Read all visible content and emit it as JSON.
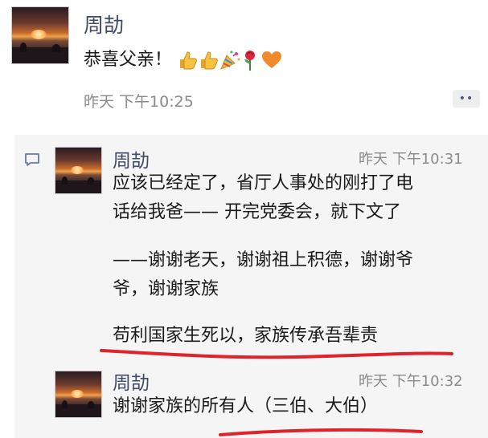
{
  "post": {
    "author": "周劼",
    "message": "恭喜父亲！",
    "emojis": [
      "thumbs-up-icon",
      "thumbs-up-icon",
      "party-popper-icon",
      "rose-icon",
      "orange-heart-icon"
    ],
    "timestamp": "昨天 下午10:25",
    "more_label": "••"
  },
  "comments": [
    {
      "author": "周劼",
      "timestamp": "昨天 下午10:31",
      "lines": [
        "应该已经定了，省厅人事处的刚打了电",
        "话给我爸—— 开完党委会，就下文了",
        "",
        "——谢谢老天，谢谢祖上积德，谢谢爷",
        "爷，谢谢家族",
        "",
        "苟利国家生死以，家族传承吾辈责"
      ]
    },
    {
      "author": "周劼",
      "timestamp": "昨天 下午10:32",
      "lines": [
        "谢谢家族的所有人（三伯、大伯）"
      ]
    }
  ],
  "colors": {
    "name": "#3e4a66",
    "highlight_underline": "#e0232a",
    "comment_bg": "#f5f5f5"
  }
}
